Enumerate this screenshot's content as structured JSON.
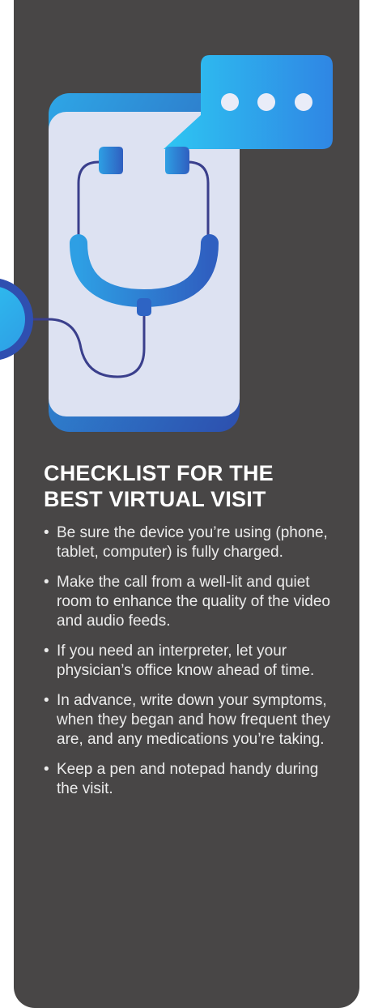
{
  "heading": {
    "line1": "CHECKLIST FOR THE",
    "line2": "BEST VIRTUAL VISIT"
  },
  "checklist": {
    "bullet": "•",
    "items": [
      "Be sure the device you’re using (phone, tablet, computer) is fully charged.",
      "Make the call from a well-lit and quiet room to enhance the quality of the video and audio feeds.",
      "If you need an interpreter, let your physician’s office know ahead of time.",
      "In advance, write down your symptoms, when they began and how frequent they are, and any medications you’re taking.",
      "Keep a pen and notepad handy during the visit."
    ]
  },
  "illustration": {
    "icons": [
      "smartphone-icon",
      "chat-bubble-icon",
      "stethoscope-icon"
    ]
  },
  "colors": {
    "panel_background": "#484646",
    "heading_text": "#ffffff",
    "body_text": "#ececec",
    "phone_frame_light": "#2ea6e6",
    "phone_frame_dark": "#2d4fae",
    "phone_screen": "#dde2f2",
    "bubble_light": "#2ec6f2",
    "bubble_dark": "#2f86e4",
    "stethoscope_tube": "#3a3f8c"
  }
}
